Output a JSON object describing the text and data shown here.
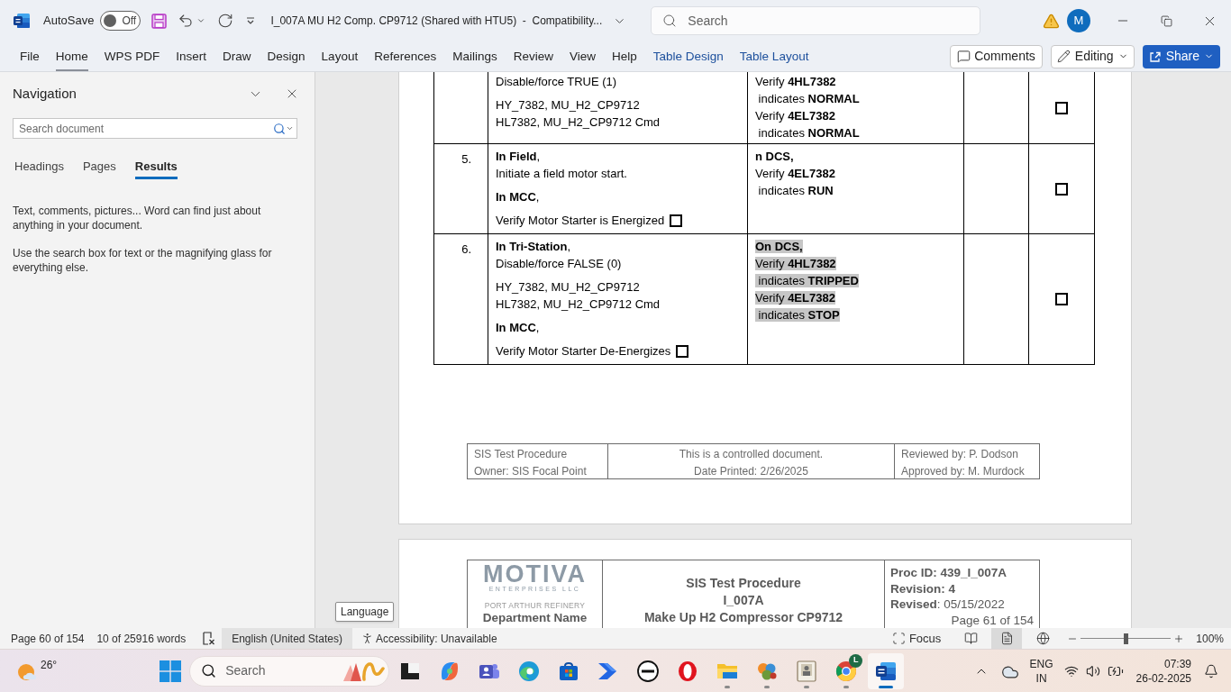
{
  "title_bar": {
    "autosave_label": "AutoSave",
    "autosave": {
      "label": "Off",
      "on": false
    },
    "document_title": "I_007A MU H2 Comp. CP9712 (Shared with HTU5)  -  Compatibility...",
    "search_placeholder": "Search",
    "account_initial": "M"
  },
  "ribbon": {
    "tabs": [
      {
        "label": "File",
        "selected": false,
        "contextual": false
      },
      {
        "label": "Home",
        "selected": true,
        "contextual": false
      },
      {
        "label": "WPS PDF",
        "selected": false,
        "contextual": false
      },
      {
        "label": "Insert",
        "selected": false,
        "contextual": false
      },
      {
        "label": "Draw",
        "selected": false,
        "contextual": false
      },
      {
        "label": "Design",
        "selected": false,
        "contextual": false
      },
      {
        "label": "Layout",
        "selected": false,
        "contextual": false
      },
      {
        "label": "References",
        "selected": false,
        "contextual": false
      },
      {
        "label": "Mailings",
        "selected": false,
        "contextual": false
      },
      {
        "label": "Review",
        "selected": false,
        "contextual": false
      },
      {
        "label": "View",
        "selected": false,
        "contextual": false
      },
      {
        "label": "Help",
        "selected": false,
        "contextual": false
      },
      {
        "label": "Table Design",
        "selected": false,
        "contextual": true
      },
      {
        "label": "Table Layout",
        "selected": false,
        "contextual": true
      }
    ],
    "comments": "Comments",
    "editing": "Editing",
    "share": "Share"
  },
  "navigation": {
    "title": "Navigation",
    "search_placeholder": "Search document",
    "tabs": [
      {
        "label": "Headings",
        "selected": false
      },
      {
        "label": "Pages",
        "selected": false
      },
      {
        "label": "Results",
        "selected": true
      }
    ],
    "paragraphs": [
      "Text, comments, pictures... Word can find just about anything in your document.",
      "Use the search box for text or the magnifying glass for everything else."
    ]
  },
  "document": {
    "steps": [
      {
        "action": [
          {
            "lines": [
              "Disable/force TRUE (1)"
            ]
          },
          {
            "lines": [
              "HY_7382, MU_H2_CP9712",
              "HL7382, MU_H2_CP9712 Cmd"
            ]
          }
        ],
        "expected": {
          "selected": false,
          "lines": [
            "Verify **4HL7382**",
            " indicates **NORMAL**",
            "Verify **4EL7382**",
            " indicates **NORMAL**"
          ]
        },
        "checkbox": {
          "checked": false
        }
      },
      {
        "number": "5.",
        "action": [
          {
            "lines": [
              "**In Field**,",
              "Initiate a field motor start."
            ]
          },
          {
            "lines": [
              "**In MCC**,"
            ]
          },
          {
            "lines": [
              "Verify Motor Starter is Energized"
            ],
            "checkbox": {
              "checked": false
            }
          }
        ],
        "expected": {
          "selected": false,
          "lines": [
            "**n DCS,**",
            "Verify **4EL7382**",
            " indicates **RUN**"
          ]
        },
        "checkbox": {
          "checked": false
        }
      },
      {
        "number": "6.",
        "action": [
          {
            "lines": [
              "**In Tri-Station**,",
              "Disable/force FALSE (0)"
            ]
          },
          {
            "lines": [
              "HY_7382, MU_H2_CP9712",
              "HL7382, MU_H2_CP9712 Cmd"
            ]
          },
          {
            "lines": [
              "**In MCC**,"
            ]
          },
          {
            "lines": [
              "Verify Motor Starter De-Energizes"
            ],
            "checkbox": {
              "checked": false
            }
          }
        ],
        "expected": {
          "selected": true,
          "lines": [
            "**On DCS,**",
            "Verify **4HL7382**",
            " indicates **TRIPPED**",
            "Verify **4EL7382**",
            " indicates **STOP**"
          ]
        },
        "checkbox": {
          "checked": false
        }
      }
    ],
    "footer": {
      "left": [
        "SIS Test Procedure",
        "Owner: SIS Focal Point"
      ],
      "center": [
        "This is a controlled document.",
        "Date Printed: 2/26/2025"
      ],
      "right": [
        "Reviewed by: P. Dodson",
        "Approved by: M. Murdock"
      ]
    },
    "next_page_header": {
      "logo": {
        "name": "MOTIVA",
        "subtitle": "ENTERPRISES LLC"
      },
      "site": "PORT ARTHUR REFINERY",
      "department": "Department Name",
      "title_lines": [
        "SIS Test Procedure",
        "I_007A",
        "Make Up H2 Compressor CP9712"
      ],
      "info_lines": [
        {
          "kind": "field",
          "text": "**Proc ID: 439_I_007A**"
        },
        {
          "kind": "field",
          "text": "**Revision: 4**"
        },
        {
          "kind": "field",
          "text": "**Revised**: 05/15/2022"
        },
        {
          "kind": "page",
          "text": "Page 61 of 154"
        }
      ]
    }
  },
  "tooltip": "Language",
  "status_bar": {
    "page": "Page 60 of 154",
    "words": "10 of 25916 words",
    "language": {
      "label": "English (United States)",
      "hovered": true
    },
    "accessibility": "Accessibility: Unavailable",
    "focus": "Focus",
    "views": [
      {
        "kind": "read",
        "selected": false
      },
      {
        "kind": "print",
        "selected": true
      },
      {
        "kind": "web",
        "selected": false
      }
    ],
    "zoom": {
      "level": 0.5,
      "reading": "100%"
    }
  },
  "taskbar": {
    "weather": "26°",
    "search_placeholder": "Search",
    "apps": [
      {
        "kind": "tile",
        "running": false,
        "active": false
      },
      {
        "kind": "swirl",
        "running": false,
        "active": false
      },
      {
        "kind": "people",
        "running": false,
        "active": false
      },
      {
        "kind": "wave",
        "running": false,
        "active": false
      },
      {
        "kind": "bag",
        "running": false,
        "active": false
      },
      {
        "kind": "arrow",
        "running": false,
        "active": false
      },
      {
        "kind": "ringlogo",
        "running": false,
        "active": false
      },
      {
        "kind": "ring",
        "running": false,
        "active": false
      },
      {
        "kind": "folder",
        "running": true,
        "active": false
      },
      {
        "kind": "puzzle",
        "running": true,
        "active": false
      },
      {
        "kind": "frame",
        "running": true,
        "active": false
      },
      {
        "kind": "browser",
        "running": true,
        "active": false,
        "badge": "L"
      },
      {
        "kind": "document",
        "running": true,
        "active": true
      }
    ],
    "language": [
      "ENG",
      "IN"
    ],
    "time": "07:39",
    "date": "26-02-2025"
  }
}
